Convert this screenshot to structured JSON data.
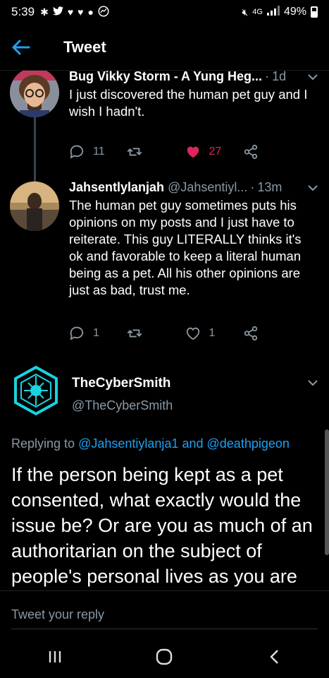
{
  "status_bar": {
    "time": "5:39",
    "network": "4G",
    "battery": "49%"
  },
  "header": {
    "title": "Tweet"
  },
  "tweets": [
    {
      "name": "Bug Vikky Storm - A Yung Heg...",
      "time": "1d",
      "text": "I just discovered the human pet guy and I wish I hadn't.",
      "replies": "11",
      "likes": "27"
    },
    {
      "name": "Jahsentlylanjah",
      "handle": "@Jahsentiyl...",
      "time": "13m",
      "text": "The human pet guy sometimes puts his opinions on my posts and I just have to reiterate. This guy LITERALLY thinks it's ok and favorable to keep a literal human being as a pet. All his other opinions are just as bad, trust me.",
      "replies": "1",
      "likes": "1"
    }
  ],
  "main_tweet": {
    "name": "TheCyberSmith",
    "handle": "@TheCyberSmith",
    "replying_prefix": "Replying to",
    "mention1": "@Jahsentiylanja1",
    "and_word": "and",
    "mention2": "@deathpigeon",
    "text": "If the person being kept as a pet consented, what exactly would the issue be? Or are you as much of an authoritarian on the subject of people's personal lives as you are on the topic of their economic"
  },
  "reply_bar": {
    "placeholder": "Tweet your reply"
  },
  "colors": {
    "accent": "#1da1f2",
    "like": "#e0245e",
    "muted": "#8899a6",
    "background": "#000000"
  }
}
